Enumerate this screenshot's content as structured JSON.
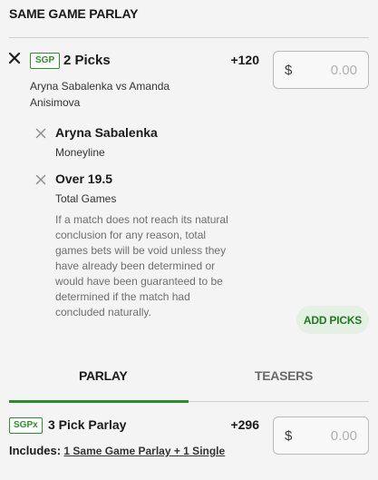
{
  "section_title": "SAME GAME PARLAY",
  "sgp": {
    "badge": "SGP",
    "title": "2 Picks",
    "odds": "+120",
    "matchup": "Aryna Sabalenka vs Amanda Anisimova",
    "wager": {
      "currency": "$",
      "placeholder": "0.00"
    }
  },
  "legs": [
    {
      "name": "Aryna Sabalenka",
      "market": "Moneyline"
    },
    {
      "name": "Over 19.5",
      "market": "Total Games"
    }
  ],
  "disclaimer": "If a match does not reach its natural conclusion for any reason, total games bets will be void unless they have already been determined or would have been guaranteed to be determined if the match had concluded naturally.",
  "add_picks_label": "ADD PICKS",
  "tabs": [
    {
      "label": "PARLAY",
      "active": true
    },
    {
      "label": "TEASERS",
      "active": false
    }
  ],
  "parlay": {
    "badge": "SGPx",
    "title": "3 Pick Parlay",
    "odds": "+296",
    "wager": {
      "currency": "$",
      "placeholder": "0.00"
    },
    "includes_label": "Includes:",
    "includes_link": "1 Same Game Parlay + 1 Single"
  },
  "colors": {
    "accent": "#2a8f2a",
    "add_picks_bg": "#e3f0e3",
    "background": "#f4f4f4"
  }
}
